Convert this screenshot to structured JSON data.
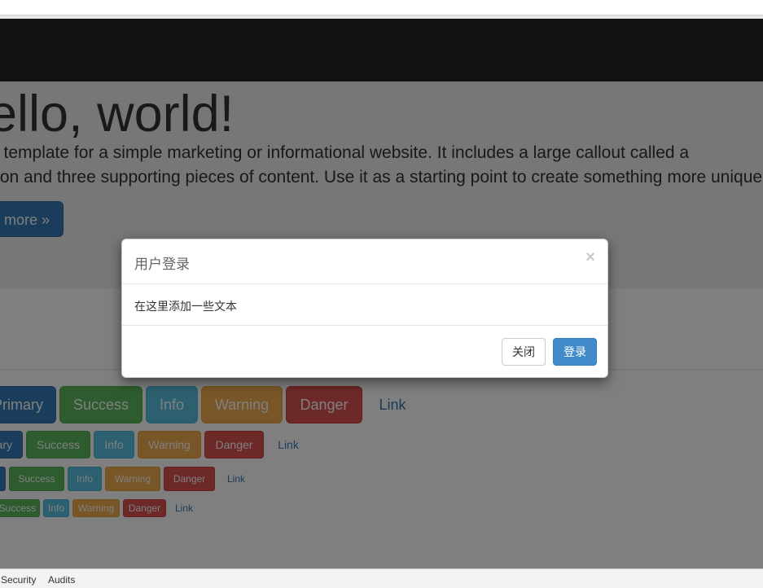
{
  "jumbotron": {
    "title": "ello, world!",
    "line1": "a template for a simple marketing or informational website. It includes a large callout called a",
    "line2": "tron and three supporting pieces of content. Use it as a starting point to create something more unique",
    "learn_more": "more »"
  },
  "buttons": {
    "lg": [
      "Primary",
      "Success",
      "Info",
      "Warning",
      "Danger",
      "Link"
    ],
    "md": [
      "ary",
      "Success",
      "Info",
      "Warning",
      "Danger",
      "Link"
    ],
    "sm": [
      "Success",
      "Info",
      "Warning",
      "Danger",
      "Link"
    ],
    "xs": [
      "Success",
      "Info",
      "Warning",
      "Danger",
      "Link"
    ]
  },
  "modal": {
    "title": "用户登录",
    "close_symbol": "×",
    "body": "在这里添加一些文本",
    "close_label": "关闭",
    "login_label": "登录"
  },
  "devtools": {
    "tabs": [
      "Security",
      "Audits"
    ]
  }
}
